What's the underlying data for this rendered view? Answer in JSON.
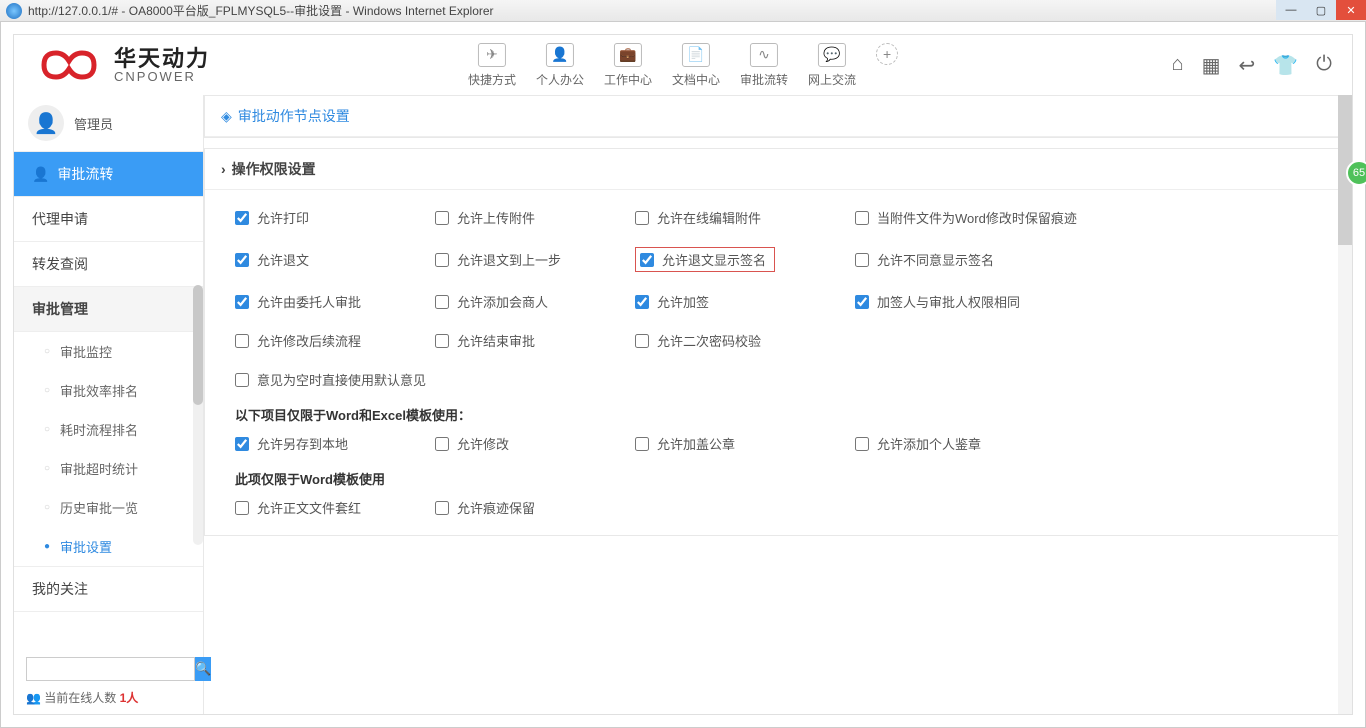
{
  "window": {
    "url": "http://127.0.0.1/#",
    "title_sep": " - ",
    "title_app": "OA8000平台版_FPLMYSQL5--审批设置",
    "title_browser": "Windows Internet Explorer"
  },
  "logo": {
    "cn": "华天动力",
    "en": "CNPOWER"
  },
  "nav": {
    "quick": "快捷方式",
    "personal": "个人办公",
    "work": "工作中心",
    "doc": "文档中心",
    "approval": "审批流转",
    "chat": "网上交流"
  },
  "user": {
    "name": "管理员"
  },
  "sidebar": {
    "active": "审批流转",
    "items": {
      "proxy": "代理申请",
      "forward": "转发查阅"
    },
    "group": "审批管理",
    "subs": {
      "monitor": "审批监控",
      "rank": "审批效率排名",
      "time": "耗时流程排名",
      "timeout": "审批超时统计",
      "history": "历史审批一览",
      "settings": "审批设置"
    },
    "myfollow": "我的关注",
    "online_label": "当前在线人数 ",
    "online_count": "1人"
  },
  "panels": {
    "node": {
      "title": "审批动作节点设置"
    },
    "perm": {
      "title": "操作权限设置",
      "row1": {
        "c1": "允许打印",
        "c2": "允许上传附件",
        "c3": "允许在线编辑附件",
        "c4": "当附件文件为Word修改时保留痕迹"
      },
      "row2": {
        "c1": "允许退文",
        "c2": "允许退文到上一步",
        "c3": "允许退文显示签名",
        "c4": "允许不同意显示签名"
      },
      "row3": {
        "c1": "允许由委托人审批",
        "c2": "允许添加会商人",
        "c3": "允许加签",
        "c4": "加签人与审批人权限相同"
      },
      "row4": {
        "c1": "允许修改后续流程",
        "c2": "允许结束审批",
        "c3": "允许二次密码校验"
      },
      "row5": {
        "c1": "意见为空时直接使用默认意见"
      },
      "note1": "以下项目仅限于Word和Excel模板使用：",
      "row6": {
        "c1": "允许另存到本地",
        "c2": "允许修改",
        "c3": "允许加盖公章",
        "c4": "允许添加个人鉴章"
      },
      "note2": "此项仅限于Word模板使用",
      "row7": {
        "c1": "允许正文文件套红",
        "c2": "允许痕迹保留"
      }
    }
  },
  "badge": "65"
}
